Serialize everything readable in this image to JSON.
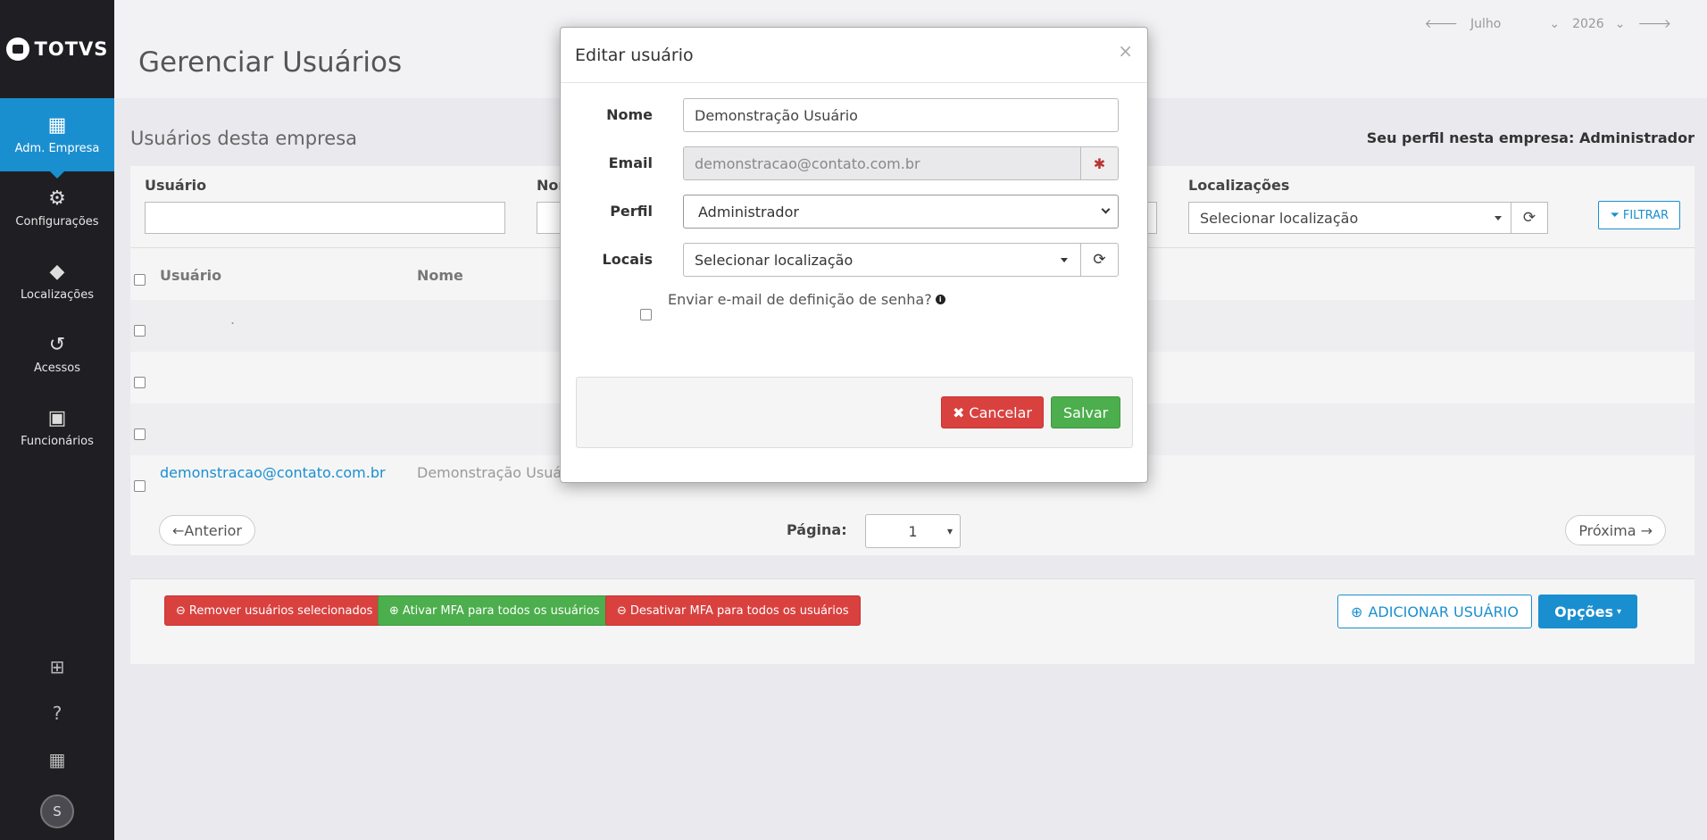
{
  "brand": {
    "logo_text": "TOTVS"
  },
  "sidebar": {
    "items": [
      {
        "label": "Adm. Empresa",
        "icon": "building-gear-icon",
        "glyph": "▦",
        "active": true
      },
      {
        "label": "Configurações",
        "icon": "gear-icon",
        "glyph": "⚙",
        "active": false
      },
      {
        "label": "Localizações",
        "icon": "tag-icon",
        "glyph": "◆",
        "active": false
      },
      {
        "label": "Acessos",
        "icon": "history-icon",
        "glyph": "↺",
        "active": false
      },
      {
        "label": "Funcionários",
        "icon": "id-badge-icon",
        "glyph": "▣",
        "active": false
      }
    ],
    "bottom": [
      {
        "icon": "apps-grid-icon",
        "glyph": "⊞"
      },
      {
        "icon": "help-icon",
        "glyph": "?"
      },
      {
        "icon": "company-icon",
        "glyph": "▦"
      }
    ],
    "avatar_initial": "S"
  },
  "header": {
    "title": "Gerenciar Usuários",
    "month": "Julho",
    "year": "2026"
  },
  "section": {
    "title": "Usuários desta empresa",
    "profile_label": "Seu perfil nesta empresa:",
    "profile_value": "Administrador"
  },
  "filters": {
    "usuario_label": "Usuário",
    "nome_label": "Nor",
    "localizacoes_label": "Localizações",
    "localizacoes_placeholder": "Selecionar localização",
    "filter_button": "FILTRAR"
  },
  "table": {
    "columns": [
      "Usuário",
      "Nome"
    ],
    "rows": [
      {
        "usuario": ".",
        "nome": ""
      },
      {
        "usuario": "",
        "nome": ""
      },
      {
        "usuario": "",
        "nome": ""
      },
      {
        "usuario": "demonstracao@contato.com.br",
        "nome": "Demonstração Usuário"
      }
    ]
  },
  "pagination": {
    "prev": "←Anterior",
    "page_label": "Página:",
    "page_value": "1",
    "next": "Próxima →"
  },
  "actions": {
    "remove": "Remover usuários selecionados",
    "enable_mfa": "Ativar MFA para todos os usuários",
    "disable_mfa": "Desativar MFA para todos os usuários",
    "add_user": "ADICIONAR USUÁRIO",
    "options": "Opções"
  },
  "modal": {
    "title": "Editar usuário",
    "close": "×",
    "nome_label": "Nome",
    "nome_value": "Demonstração Usuário",
    "email_label": "Email",
    "email_value": "demonstracao@contato.com.br",
    "perfil_label": "Perfil",
    "perfil_value": "Administrador",
    "locais_label": "Locais",
    "locais_placeholder": "Selecionar localização",
    "send_email_label": "Enviar e-mail de definição de senha?",
    "cancel": "Cancelar",
    "save": "Salvar"
  },
  "colors": {
    "primary": "#1a8fd0",
    "danger": "#d9413f",
    "success": "#4cae4c",
    "sidebar": "#1f1f23"
  }
}
